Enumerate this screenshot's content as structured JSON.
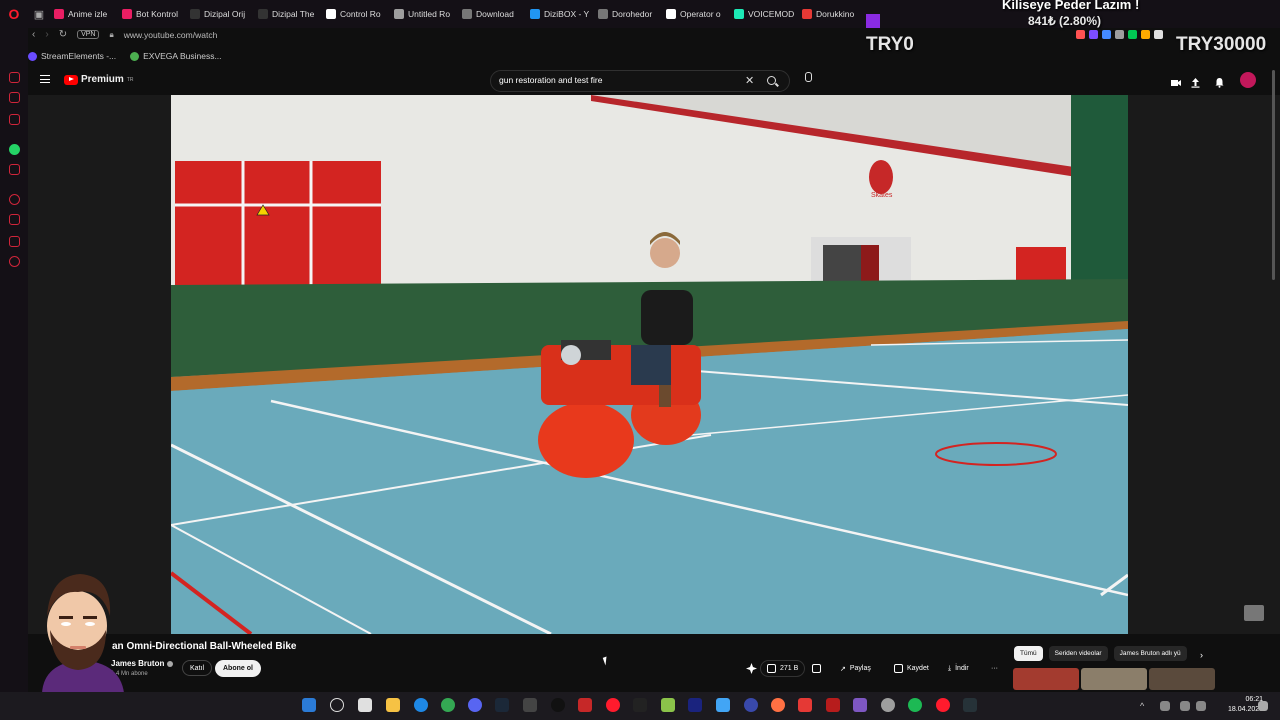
{
  "browser": {
    "tabs": [
      {
        "label": "Anime izle",
        "color": "#e91e63"
      },
      {
        "label": "Bot Kontrol",
        "color": "#e91e63"
      },
      {
        "label": "Dizipal Orij",
        "color": "#333333"
      },
      {
        "label": "Dizipal The",
        "color": "#333333"
      },
      {
        "label": "Control Ro",
        "color": "#ffffff"
      },
      {
        "label": "Untitled Ro",
        "color": "#9e9e9e"
      },
      {
        "label": "Download",
        "color": "#777777"
      },
      {
        "label": "DiziBOX - Y",
        "color": "#2196f3"
      },
      {
        "label": "Dorohedor",
        "color": "#777777"
      },
      {
        "label": "Operator o",
        "color": "#ffffff"
      },
      {
        "label": "VOICEMOD",
        "color": "#1de9b6"
      },
      {
        "label": "Dorukkino",
        "color": "#e53935"
      }
    ],
    "url": "www.youtube.com/watch",
    "vpn_label": "VPN",
    "bookmarks": [
      {
        "label": "StreamElements -...",
        "color": "#6a4cff"
      },
      {
        "label": "EXVEGA Business...",
        "color": "#4caf50"
      }
    ]
  },
  "overlay": {
    "title": "Kiliseye Peder Lazım !",
    "price": "841₺ (2.80%)",
    "left_text": "TRY0",
    "right_text": "TRY30000"
  },
  "youtube": {
    "logo_text": "Premium",
    "logo_region": "TR",
    "search": {
      "value": "gun restoration and test fire",
      "clear": "✕"
    },
    "video": {
      "title": "an Omni-Directional Ball-Wheeled Bike",
      "channel": "James Bruton",
      "subscribers": "1,4 Mn abone",
      "join_label": "Katıl",
      "subscribe_label": "Abone ol",
      "likes": "271 B",
      "share_label": "Paylaş",
      "save_label": "Kaydet",
      "download_label": "İndir",
      "gym_sign": "Skates"
    },
    "chips": [
      "Tümü",
      "Seriden videolar",
      "James Bruton adlı yü"
    ]
  },
  "taskbar": {
    "time": "06:21",
    "date": "18.04.2026"
  }
}
